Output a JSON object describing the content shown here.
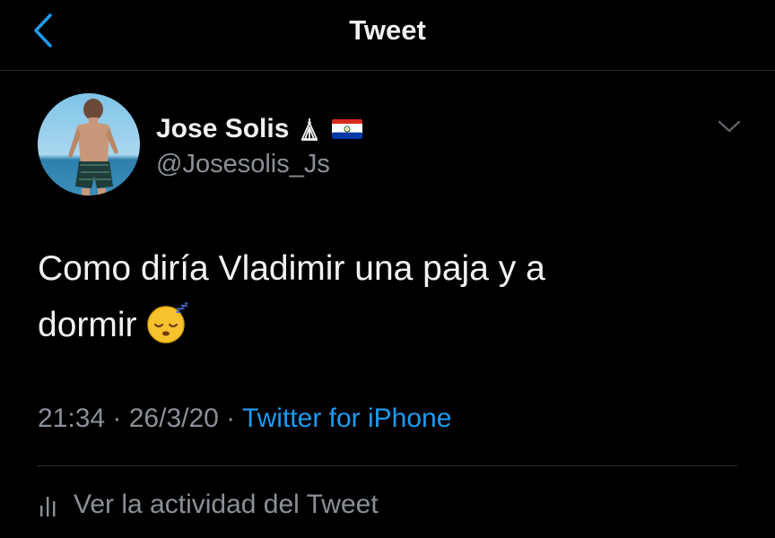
{
  "header": {
    "title": "Tweet",
    "back_icon": "chevron-left-icon"
  },
  "author": {
    "display_name": "Jose Solis",
    "handle": "@Josesolis_Js",
    "name_symbol_icon": "temple-symbol-icon",
    "flag_icon": "paraguay-flag-icon",
    "menu_icon": "chevron-down-icon"
  },
  "tweet": {
    "text_line1": "Como diría Vladimir una paja y a",
    "text_line2": "dormir",
    "emoji_icon": "sleeping-face-emoji"
  },
  "meta": {
    "time": "21:34",
    "separator1": " · ",
    "date": "26/3/20",
    "separator2": " · ",
    "source": "Twitter for iPhone"
  },
  "activity": {
    "label": "Ver la actividad del Tweet",
    "icon": "bar-chart-icon"
  },
  "colors": {
    "background": "#000000",
    "text_primary": "#f2f2f2",
    "text_secondary": "#8a9097",
    "link": "#1d9bf0",
    "divider": "#2b2f33"
  }
}
